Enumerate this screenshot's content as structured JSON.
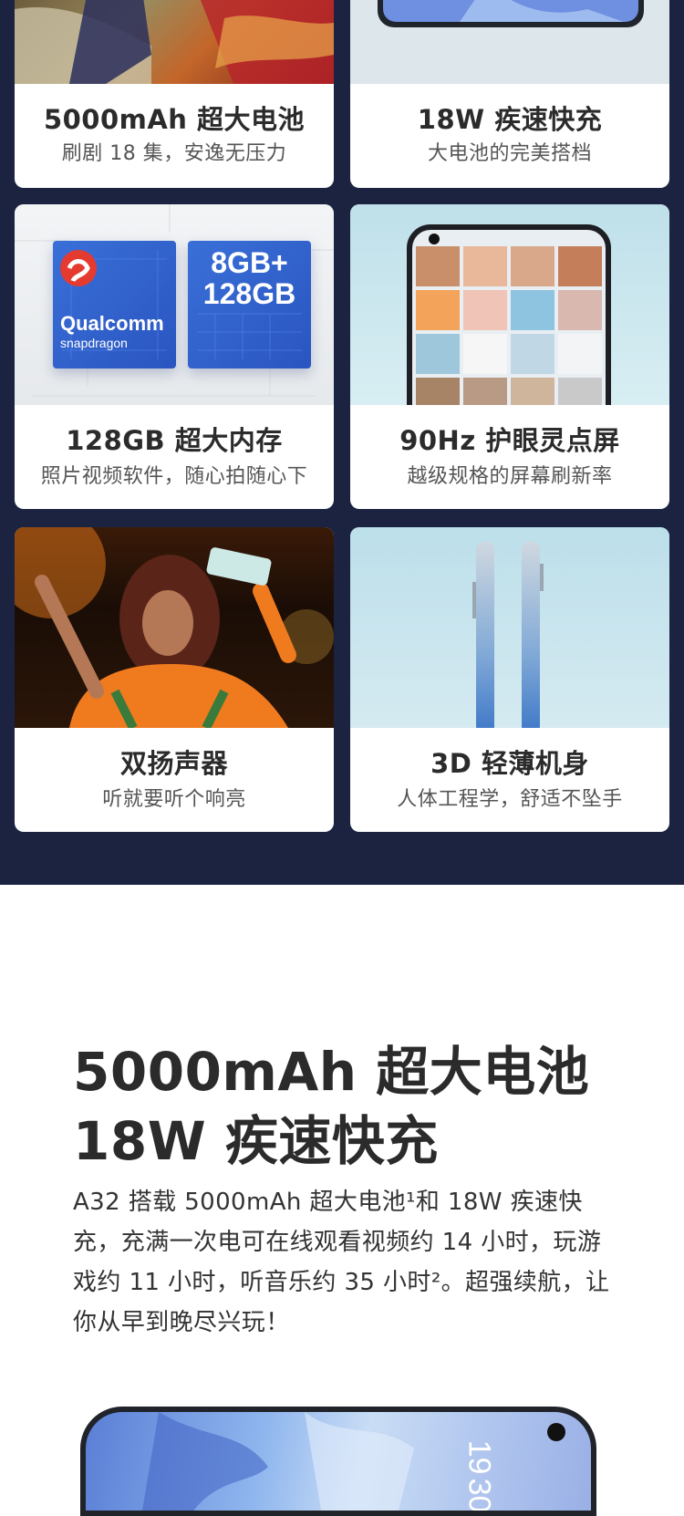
{
  "features": [
    {
      "title": "5000mAh 超大电池",
      "subtitle": "刷剧 18 集，安逸无压力"
    },
    {
      "title": "18W 疾速快充",
      "subtitle": "大电池的完美搭档"
    },
    {
      "title": "128GB 超大内存",
      "subtitle": "照片视频软件，随心拍随心下"
    },
    {
      "title": "90Hz 护眼灵点屏",
      "subtitle": "越级规格的屏幕刷新率"
    },
    {
      "title": "双扬声器",
      "subtitle": "听就要听个响亮"
    },
    {
      "title": "3D 轻薄机身",
      "subtitle": "人体工程学，舒适不坠手"
    }
  ],
  "chip_image": {
    "brand": "Qualcomm",
    "product": "snapdragon",
    "memory_line1": "8GB+",
    "memory_line2": "128GB"
  },
  "battery_section": {
    "title_line1": "5000mAh 超大电池",
    "title_line2": "18W 疾速快充",
    "description": "A32 搭载 5000mAh 超大电池¹和 18W 疾速快充，充满一次电可在线观看视频约 14 小时，玩游戏约 11 小时，听音乐约 35 小时²。超强续航，让你从早到晚尽兴玩！"
  },
  "phone_preview": {
    "clock_hour": "19",
    "clock_minute": "30"
  },
  "colors": {
    "section_bg": "#1b2341",
    "card_bg": "#ffffff",
    "title_text": "#2b2b2b",
    "subtitle_text": "#555555"
  }
}
